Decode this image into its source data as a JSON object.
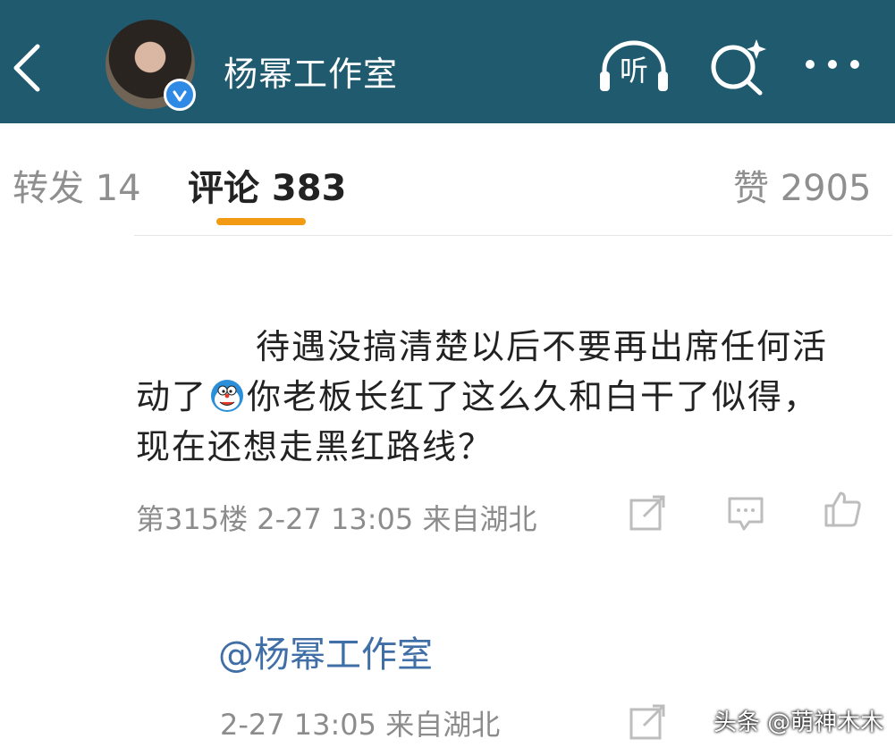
{
  "header": {
    "title": "杨幂工作室",
    "listen_label": "听"
  },
  "tabs": [
    {
      "label": "转发 14"
    },
    {
      "label": "评论 383"
    },
    {
      "label": "赞 2905"
    }
  ],
  "comment": {
    "line1": "待遇没搞清楚以后不要再出席任何活",
    "line2_before_emoji": "动了",
    "line2_after_emoji": "你老板长红了这么久和白干了似得，",
    "line3": "现在还想走黑红路线？",
    "meta": "第315楼  2-27 13:05  来自湖北"
  },
  "reply": {
    "mention": "@杨幂工作室",
    "meta": "2-27 13:05  来自湖北"
  },
  "watermark": "头条 @萌神木木",
  "colors": {
    "header_bg": "#1f5a6e",
    "tab_indicator": "#f29a12",
    "mention_blue": "#3f6fa6"
  }
}
